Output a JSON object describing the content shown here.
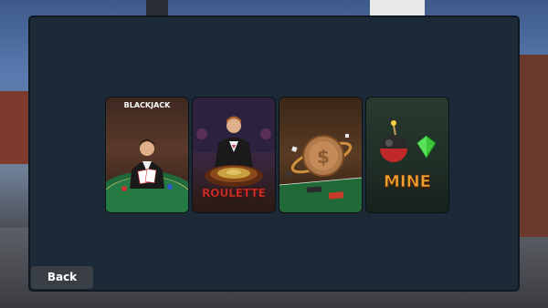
{
  "games": [
    {
      "id": "blackjack",
      "title": "BLACKJACK"
    },
    {
      "id": "roulette",
      "title": "ROULETTE"
    },
    {
      "id": "slots",
      "title": ""
    },
    {
      "id": "mine",
      "title": "MINE"
    }
  ],
  "back_label": "Back",
  "colors": {
    "panel_bg": "#1c2a38",
    "roulette_title": "#d8322a",
    "mine_title": "#f0a030",
    "back_button": "#3a3f46"
  },
  "icons": [
    "dealer-icon",
    "roulette-wheel-icon",
    "coin-icon",
    "bomb-icon",
    "gem-icon"
  ]
}
